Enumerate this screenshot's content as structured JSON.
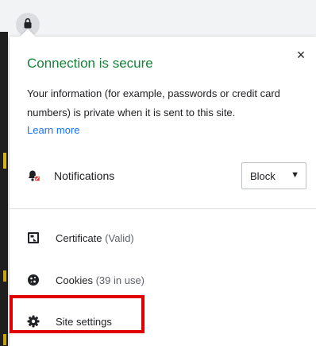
{
  "popup": {
    "title": "Connection is secure",
    "close_glyph": "×",
    "description": "Your information (for example, passwords or credit card numbers) is private when it is sent to this site.",
    "learn_more": "Learn more"
  },
  "permissions": {
    "notifications": {
      "label": "Notifications",
      "value": "Block"
    }
  },
  "items": {
    "certificate": {
      "label": "Certificate",
      "status": "(Valid)"
    },
    "cookies": {
      "label": "Cookies",
      "status": "(39 in use)"
    },
    "site_settings": {
      "label": "Site settings"
    }
  },
  "colors": {
    "secure_title": "#188038",
    "link": "#1a73e8",
    "highlight_box": "#e00000"
  },
  "icons": [
    "lock-icon",
    "close-icon",
    "notifications-blocked-icon",
    "chevron-down-icon",
    "certificate-icon",
    "cookie-icon",
    "gear-icon"
  ]
}
